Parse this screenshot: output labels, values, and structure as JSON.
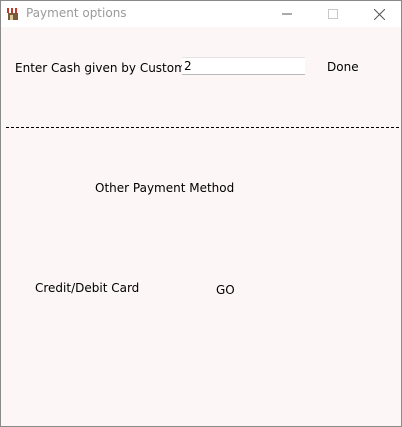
{
  "window": {
    "title": "Payment options",
    "icon": "shop-awning-icon"
  },
  "titlebar_buttons": [
    "minimize-icon",
    "maximize-icon",
    "close-icon"
  ],
  "cash": {
    "label": "Enter Cash given by Customer :",
    "value": "2"
  },
  "buttons": {
    "done": "Done",
    "card": "Credit/Debit Card",
    "go": "GO"
  },
  "other_payment_label": "Other Payment Method",
  "colors": {
    "window_bg": "#fdf6f6",
    "titlebar_bg": "#ffffff",
    "title_text": "#9a9a9a"
  }
}
